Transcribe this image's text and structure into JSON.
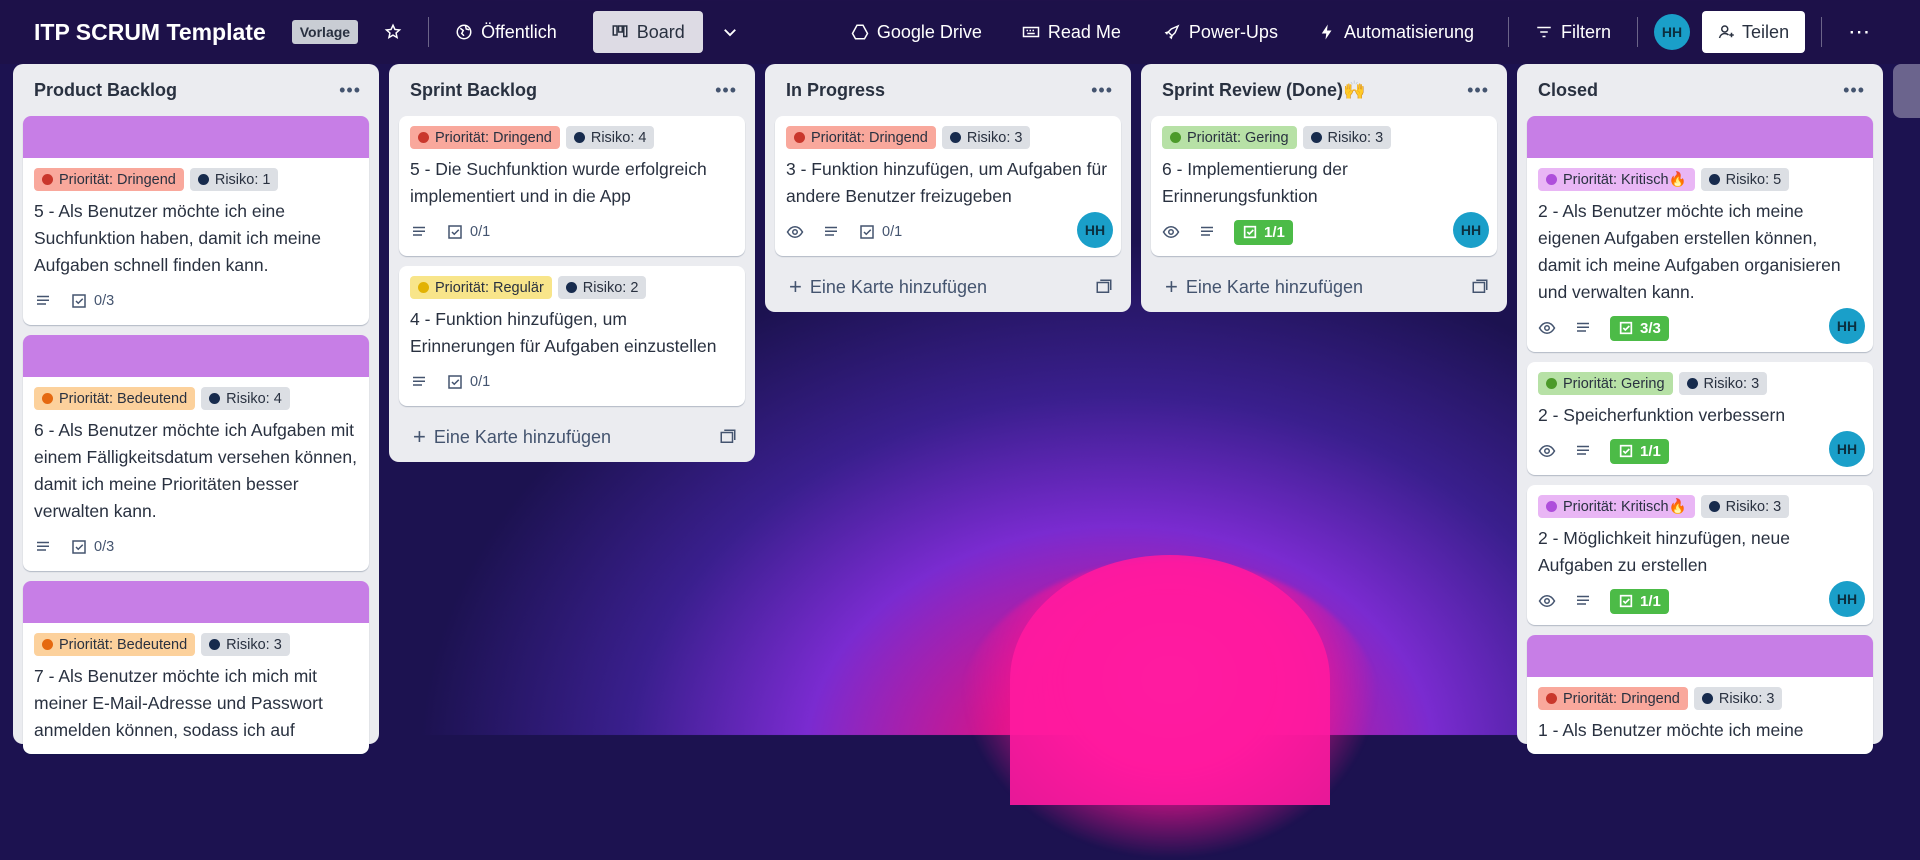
{
  "topbar": {
    "board_title": "ITP SCRUM Template",
    "template_badge": "Vorlage",
    "visibility": "Öffentlich",
    "view": "Board",
    "google_drive": "Google Drive",
    "read_me": "Read Me",
    "power_ups": "Power-Ups",
    "automation": "Automatisierung",
    "filter": "Filtern",
    "avatar": "HH",
    "share": "Teilen"
  },
  "add_card_label": "Eine Karte hinzufügen",
  "colors": {
    "cover": "#c77ee6",
    "dringend": "#f9a89c",
    "bedeutend": "#fcd19c",
    "regular": "#f8e58a",
    "gering": "#b7e1a6",
    "kritisch": "#e9b6f5",
    "risk": "#dcdfe4"
  },
  "lists": [
    {
      "title": "Product Backlog",
      "cards": [
        {
          "priority": "Priorität: Dringend",
          "risk": "Risiko: 1",
          "title": "5 - Als Benutzer möchte ich eine Suchfunktion haben, damit ich meine Aufgaben schnell finden kann.",
          "checklist": "0/3"
        },
        {
          "priority": "Priorität: Bedeutend",
          "risk": "Risiko: 4",
          "title": "6 - Als Benutzer möchte ich Aufgaben mit einem Fälligkeitsdatum versehen können, damit ich meine Prioritäten besser verwalten kann.",
          "checklist": "0/3"
        },
        {
          "priority": "Priorität: Bedeutend",
          "risk": "Risiko: 3",
          "title": "7 - Als Benutzer möchte ich mich mit meiner E-Mail-Adresse und Passwort anmelden können, sodass ich auf"
        }
      ]
    },
    {
      "title": "Sprint Backlog",
      "cards": [
        {
          "priority": "Priorität: Dringend",
          "risk": "Risiko: 4",
          "title": "5 - Die Suchfunktion wurde erfolgreich implementiert und in die App",
          "checklist": "0/1"
        },
        {
          "priority": "Priorität: Regulär",
          "risk": "Risiko: 2",
          "title": "4 - Funktion hinzufügen, um Erinnerungen für Aufgaben einzustellen",
          "checklist": "0/1"
        }
      ]
    },
    {
      "title": "In Progress",
      "cards": [
        {
          "priority": "Priorität: Dringend",
          "risk": "Risiko: 3",
          "title": "3 - Funktion hinzufügen, um Aufgaben für andere Benutzer freizugeben",
          "checklist": "0/1",
          "member": "HH"
        }
      ]
    },
    {
      "title": "Sprint Review (Done)🙌",
      "cards": [
        {
          "priority": "Priorität: Gering",
          "risk": "Risiko: 3",
          "title": "6 - Implementierung der Erinnerungsfunktion",
          "checklist": "1/1",
          "member": "HH"
        }
      ]
    },
    {
      "title": "Closed",
      "cards": [
        {
          "priority": "Priorität: Kritisch🔥",
          "risk": "Risiko: 5",
          "title": "2 - Als Benutzer möchte ich meine eigenen Aufgaben erstellen können, damit ich meine Aufgaben organisieren und verwalten kann.",
          "checklist": "3/3",
          "member": "HH"
        },
        {
          "priority": "Priorität: Gering",
          "risk": "Risiko: 3",
          "title": "2 - Speicherfunktion verbessern",
          "checklist": "1/1",
          "member": "HH"
        },
        {
          "priority": "Priorität: Kritisch🔥",
          "risk": "Risiko: 3",
          "title": "2 - Möglichkeit hinzufügen, neue Aufgaben zu erstellen",
          "checklist": "1/1",
          "member": "HH"
        },
        {
          "priority": "Priorität: Dringend",
          "risk": "Risiko: 3",
          "title": "1 - Als Benutzer möchte ich meine"
        }
      ]
    }
  ]
}
